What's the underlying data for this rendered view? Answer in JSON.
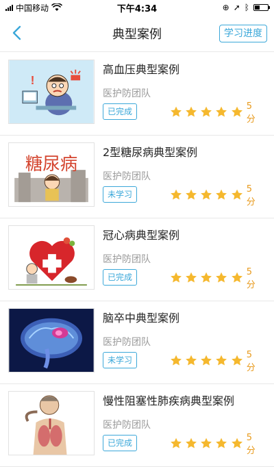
{
  "status_bar": {
    "carrier": "中国移动",
    "time": "下午4:34"
  },
  "nav": {
    "title": "典型案例",
    "progress_label": "学习进度",
    "accent_color": "#3aa7d9"
  },
  "cases": [
    {
      "title": "高血压典型案例",
      "team": "医护防团队",
      "status": "已完成",
      "rating": 5,
      "score": "5分",
      "image_icon": "hypertension-illustration"
    },
    {
      "title": "2型糖尿病典型案例",
      "team": "医护防团队",
      "status": "未学习",
      "rating": 5,
      "score": "5分",
      "image_icon": "diabetes-illustration",
      "image_text": "糖尿病"
    },
    {
      "title": "冠心病典型案例",
      "team": "医护防团队",
      "status": "已完成",
      "rating": 5,
      "score": "5分",
      "image_icon": "heart-disease-illustration"
    },
    {
      "title": "脑卒中典型案例",
      "team": "医护防团队",
      "status": "未学习",
      "rating": 5,
      "score": "5分",
      "image_icon": "brain-illustration"
    },
    {
      "title": "慢性阻塞性肺疾病典型案例",
      "team": "医护防团队",
      "status": "已完成",
      "rating": 5,
      "score": "5分",
      "image_icon": "lung-illustration"
    }
  ],
  "star_color": "#f5b82e"
}
